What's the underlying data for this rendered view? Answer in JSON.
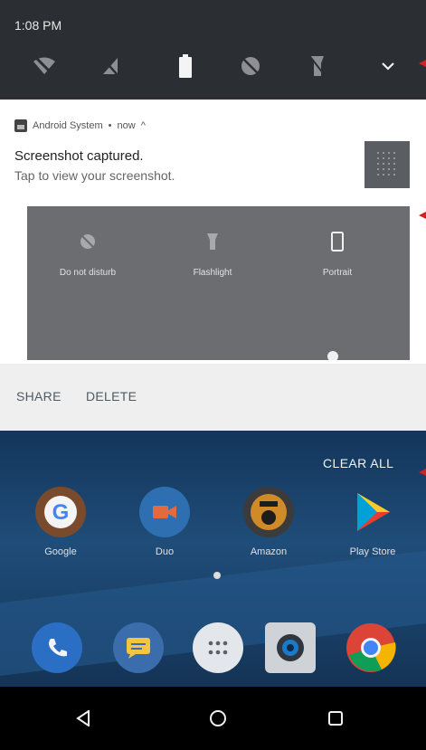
{
  "status_bar": {
    "time": "1:08 PM"
  },
  "quick_settings": {
    "icons": [
      "wifi-off-icon",
      "mobile-data-off-icon",
      "battery-icon",
      "do-not-disturb-icon",
      "flashlight-icon",
      "expand-chevron-icon"
    ]
  },
  "notification": {
    "app_name": "Android System",
    "separator": " • ",
    "time": "now",
    "expand_glyph": "^",
    "title": "Screenshot captured.",
    "text": "Tap to view your screenshot.",
    "preview_tiles": [
      {
        "icon": "do-not-disturb-icon",
        "label": "Do not disturb"
      },
      {
        "icon": "flashlight-icon",
        "label": "Flashlight"
      },
      {
        "icon": "portrait-icon",
        "label": "Portrait"
      }
    ],
    "actions": {
      "share": "SHARE",
      "delete": "DELETE"
    }
  },
  "home": {
    "clear_all": "CLEAR ALL",
    "apps": [
      {
        "icon": "google-icon",
        "label": "Google"
      },
      {
        "icon": "duo-icon",
        "label": "Duo"
      },
      {
        "icon": "amazon-icon",
        "label": "Amazon"
      },
      {
        "icon": "play-store-icon",
        "label": "Play Store"
      }
    ],
    "dock": [
      "phone-icon",
      "messages-icon",
      "app-drawer-icon",
      "camera-icon",
      "chrome-icon"
    ]
  },
  "navigation": [
    "back-icon",
    "home-icon",
    "recents-icon"
  ],
  "colors": {
    "annotation_arrow": "#d32020",
    "qs_bar": "#2b2e33",
    "wallpaper": "#1f4d79"
  }
}
